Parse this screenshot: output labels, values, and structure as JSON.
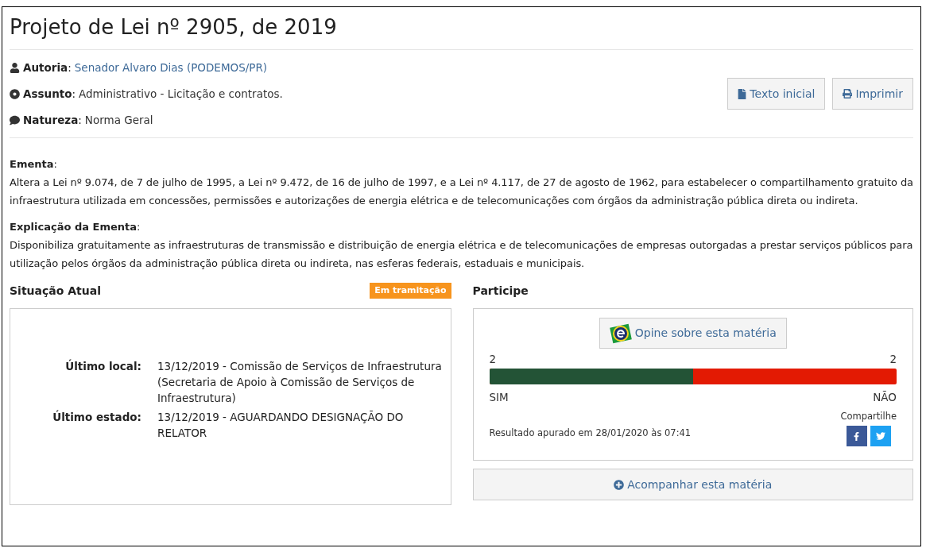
{
  "title": "Projeto de Lei nº 2905, de 2019",
  "meta": [
    {
      "kind": "author",
      "label": "**Autoria**:",
      "value": "Senador Alvaro Dias (PODEMOS/PR)",
      "link": true
    },
    {
      "kind": "subject",
      "label": "**Assunto**:",
      "value": "Administrativo - Licitação e contratos.",
      "link": false
    },
    {
      "kind": "nature",
      "label": "**Natureza**:",
      "value": "Norma Geral",
      "link": false
    }
  ],
  "buttons": [
    {
      "kind": "document",
      "label": "Texto inicial"
    },
    {
      "kind": "print",
      "label": "Imprimir"
    }
  ],
  "sections": [
    {
      "heading": "**Ementa**:",
      "body": "Altera a Lei nº 9.074, de 7 de julho de 1995, a Lei nº 9.472, de 16 de julho de 1997, e a Lei nº 4.117, de 27 de agosto de 1962, para estabelecer o compartilhamento gratuito da infraestrutura utilizada em concessões, permissões e autorizações de energia elétrica e de telecomunicações com órgãos da administração pública direta ou indireta."
    },
    {
      "heading": "**Explicação da Ementa**:",
      "body": "Disponibiliza gratuitamente as infraestruturas de transmissão e distribuição de energia elétrica e de telecomunicações de empresas outorgadas a prestar serviços públicos para utilização pelos órgãos da administração pública direta ou indireta, nas esferas federais, estaduais e municipais."
    }
  ],
  "situacao": {
    "heading": "Situação Atual",
    "badge": "Em tramitação",
    "rows": [
      {
        "label": "Último local:",
        "value": "13/12/2019 - Comissão de Serviços de Infraestrutura (Secretaria de Apoio à Comissão de Serviços de Infraestrutura)"
      },
      {
        "label": "Último estado:",
        "value": "13/12/2019 - AGUARDANDO DESIGNAÇÃO DO RELATOR"
      }
    ]
  },
  "participe": {
    "heading": "Participe",
    "opine": "Opine sobre esta matéria",
    "yes_count": "2",
    "no_count": "2",
    "level": 0.5,
    "yes_label": "SIM",
    "no_label": "NÃO",
    "result": "Resultado apurado em 28/01/2020 às 07:41",
    "share": "Compartilhe",
    "follow": "Acompanhar esta matéria"
  }
}
